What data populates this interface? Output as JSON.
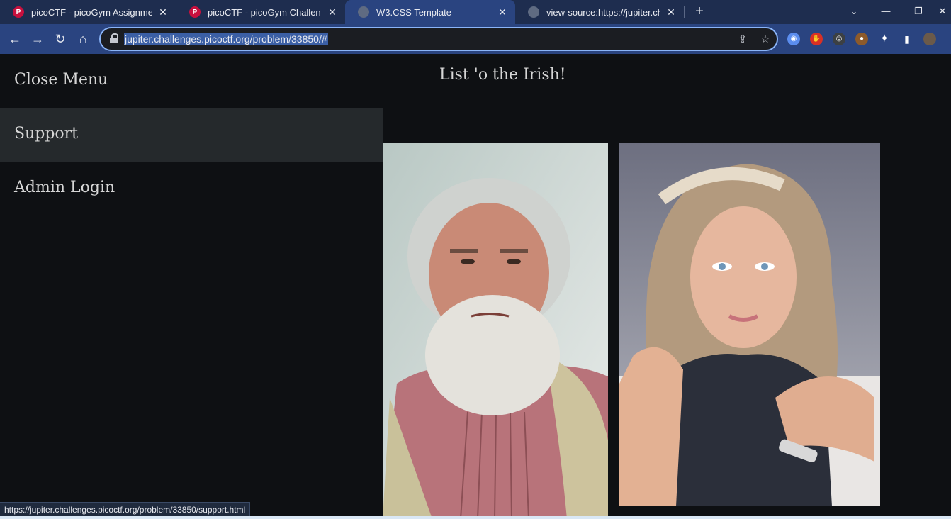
{
  "browser": {
    "tabs": [
      {
        "title": "picoCTF - picoGym Assignments",
        "icon": "picoctf-icon",
        "active": false
      },
      {
        "title": "picoCTF - picoGym Challenges",
        "icon": "picoctf-icon",
        "active": false
      },
      {
        "title": "W3.CSS Template",
        "icon": "globe-icon",
        "active": true
      },
      {
        "title": "view-source:https://jupiter.challe",
        "icon": "globe-icon",
        "active": false
      }
    ],
    "address": "jupiter.challenges.picoctf.org/problem/33850/#",
    "status_url": "https://jupiter.challenges.picoctf.org/problem/33850/support.html",
    "colors": {
      "tabstrip": "#1e2d4f",
      "toolbar": "#2a4480",
      "omnibox_border": "#8ab4f8"
    }
  },
  "sidebar": {
    "items": [
      {
        "label": "Close Menu"
      },
      {
        "label": "Support",
        "hovered": true
      },
      {
        "label": "Admin Login"
      }
    ]
  },
  "main": {
    "heading": "List 'o the Irish!",
    "photos": [
      {
        "subject": "bearded older man portrait"
      },
      {
        "subject": "blonde woman portrait"
      }
    ]
  }
}
